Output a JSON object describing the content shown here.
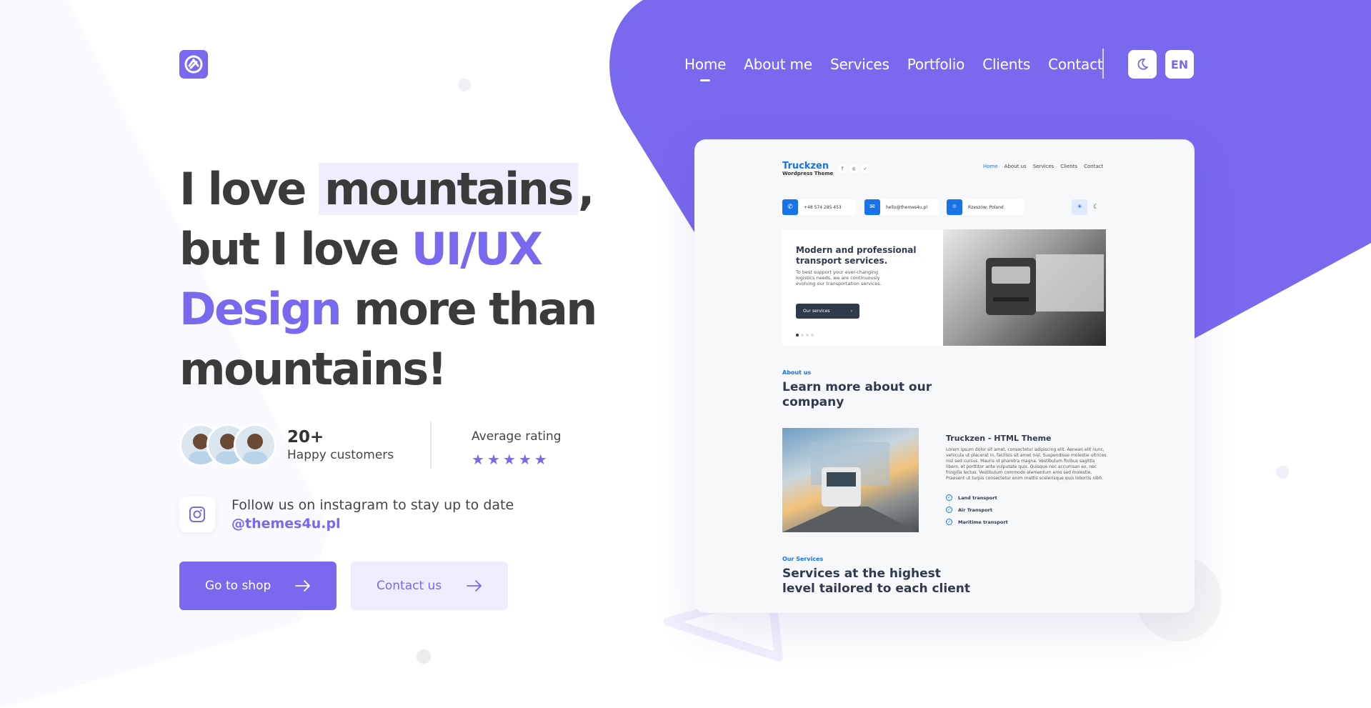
{
  "nav": {
    "items": [
      "Home",
      "About me",
      "Services",
      "Portfolio",
      "Clients",
      "Contact"
    ],
    "active": "Home",
    "lang": "EN"
  },
  "icons": {
    "logo": "logo-mark-icon",
    "theme": "moon-icon",
    "instagram": "instagram-icon",
    "arrow": "arrow-right-icon",
    "star": "star-icon"
  },
  "hero": {
    "line1_a": "I love ",
    "line1_hl": "mountains",
    "line1_b": ",",
    "line2_a": "but I love ",
    "line2_accent": "UI/UX",
    "line3_accent": "Design",
    "line3_b": " more than",
    "line4": "mountains!"
  },
  "stats": {
    "customers_count": "20+",
    "customers_label": "Happy customers",
    "rating_label": "Average rating",
    "rating_stars": 5
  },
  "instagram": {
    "text": "Follow us on instagram to stay up to date",
    "handle": "@themes4u.pl"
  },
  "buttons": {
    "shop": "Go to shop",
    "contact": "Contact us"
  },
  "colors": {
    "accent": "#7869ef",
    "accent_light": "#efedfd",
    "mockup_blue": "#1973e8"
  },
  "mockup": {
    "brand": "Truckzen",
    "brand_sub": "Wordpress Theme",
    "social": [
      "f",
      "◎",
      "✓"
    ],
    "nav": [
      "Home",
      "About us",
      "Services",
      "Clients",
      "Contact"
    ],
    "phone": "+48 574 285 453",
    "email": "hello@themes4u.pl",
    "location": "Rzeszów, Poland",
    "hero_title": "Modern and professional transport services.",
    "hero_text": "To best support your ever-changing logistics needs, we are continuously evolving our transportation services.",
    "hero_btn": "Our services",
    "about_kicker": "About us",
    "about_title": "Learn more about our company",
    "theme_title": "Truckzen - HTML Theme",
    "theme_text": "Lorem ipsum dolor sit amet, consectetur adipiscing elit. Aenean elit nunc, vehicula ut placerat in, facilisis sit amet nisl. Suspendisse molestie ultrices nisl sed cursus. Mauris id pharetra magna. Vestibulum finibus sagittis libero, et porttitor ante vulputate quis. Quisque nec accumsan ex, nec fringilla lectus. Vestibulum commodo elementum eros sed molestie. Praesent ut turpis consectetur enim mattis scelerisque quis lobortis nibh.",
    "checks": [
      "Land transport",
      "Air Transport",
      "Maritime transport"
    ],
    "services_kicker": "Our Services",
    "services_title": "Services at the highest level tailored to each client"
  }
}
